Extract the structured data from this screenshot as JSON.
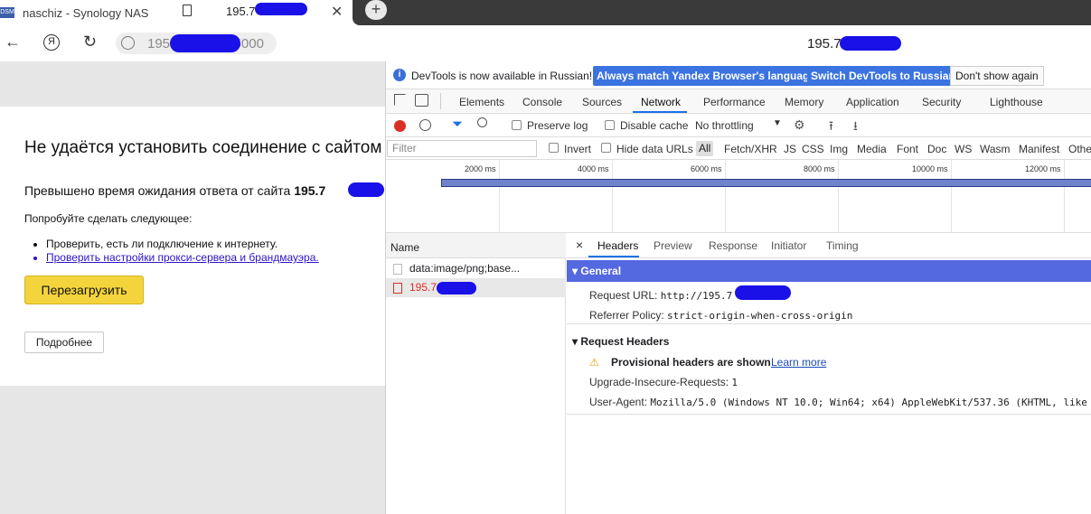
{
  "browser": {
    "tabs": [
      {
        "favicon": "DSM",
        "title": "naschiz - Synology NAS"
      },
      {
        "title": "195.7"
      }
    ],
    "new_tab_symbol": "+",
    "close_symbol": "✕",
    "address": "195.7    5000",
    "address_prefix": "195.7",
    "address_suffix": "5000",
    "page_host": "195.7",
    "nav": {
      "back": "←",
      "yandex": "Я",
      "reload": "↻"
    }
  },
  "error_page": {
    "title": "Не удаётся установить соединение с сайтом",
    "timeout_text": "Превышено время ожидания ответа от сайта ",
    "timeout_host": "195.7",
    "try_text": "Попробуйте сделать следующее:",
    "suggestions": [
      "Проверить, есть ли подключение к интернету.",
      "Проверить настройки прокси-сервера и брандмауэра."
    ],
    "reload_button": "Перезагрузить",
    "details_button": "Подробнее"
  },
  "devtools": {
    "infobar": {
      "icon": "i",
      "text": "DevTools is now available in Russian!",
      "btn_match": "Always match Yandex Browser's language",
      "btn_switch": "Switch DevTools to Russian",
      "btn_dont_show": "Don't show again"
    },
    "panel_tabs": [
      "Elements",
      "Console",
      "Sources",
      "Network",
      "Performance",
      "Memory",
      "Application",
      "Security",
      "Lighthouse"
    ],
    "active_panel": "Network",
    "toolbar": {
      "preserve_log": "Preserve log",
      "disable_cache": "Disable cache",
      "throttling": "No throttling"
    },
    "filter": {
      "placeholder": "Filter",
      "invert": "Invert",
      "hide_data_urls": "Hide data URLs",
      "types": [
        "All",
        "Fetch/XHR",
        "JS",
        "CSS",
        "Img",
        "Media",
        "Font",
        "Doc",
        "WS",
        "Wasm",
        "Manifest",
        "Other"
      ]
    },
    "timeline_ticks": [
      "2000 ms",
      "4000 ms",
      "6000 ms",
      "8000 ms",
      "10000 ms",
      "12000 ms"
    ],
    "request_list": {
      "header": "Name",
      "rows": [
        {
          "name": "data:image/png;base..."
        },
        {
          "name": "195.7"
        }
      ]
    },
    "details": {
      "close": "×",
      "tabs": [
        "Headers",
        "Preview",
        "Response",
        "Initiator",
        "Timing"
      ],
      "active_tab": "Headers",
      "general_title": "General",
      "request_url_label": "Request URL:",
      "request_url_value": "http://195.7        :5000/",
      "referrer_label": "Referrer Policy:",
      "referrer_value": "strict-origin-when-cross-origin",
      "request_headers_title": "Request Headers",
      "provisional_warning": "Provisional headers are shown",
      "learn_more": "Learn more",
      "upgrade_label": "Upgrade-Insecure-Requests:",
      "upgrade_value": "1",
      "ua_label": "User-Agent:",
      "ua_value": "Mozilla/5.0 (Windows NT 10.0; Win64; x64) AppleWebKit/537.36 (KHTML, like"
    }
  },
  "colors": {
    "accent_blue": "#3b73e0",
    "general_header": "#5468e0",
    "reload_yellow": "#f4d43c",
    "error_red": "#d93025",
    "redaction": "#1a10e8"
  }
}
